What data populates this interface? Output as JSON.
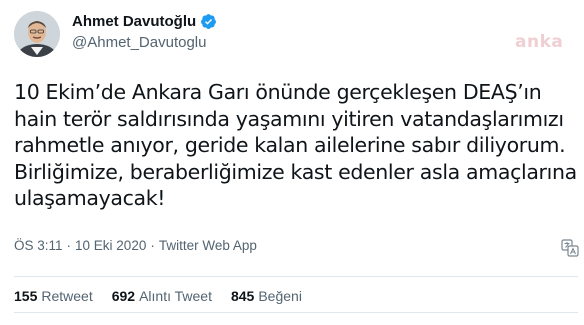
{
  "author": {
    "display_name": "Ahmet Davutoğlu",
    "handle": "@Ahmet_Davutoglu",
    "verified": true
  },
  "watermark": "anka",
  "tweet": {
    "lines": [
      "10 Ekim’de Ankara Garı önünde gerçekleşen DEAŞ’ın",
      "hain terör saldırısında yaşamını yitiren vatandaşlarımızı",
      "rahmetle anıyor, geride kalan ailelerine sabır diliyorum.",
      "Birliğimize, beraberliğimize kast edenler asla amaçlarına",
      "ulaşamayacak!"
    ]
  },
  "meta": {
    "time": "ÖS 3:11",
    "date": "10 Eki 2020",
    "source": "Twitter Web App",
    "separator": "·"
  },
  "stats": [
    {
      "count": "155",
      "label": "Retweet"
    },
    {
      "count": "692",
      "label": "Alıntı Tweet"
    },
    {
      "count": "845",
      "label": "Beğeni"
    }
  ],
  "colors": {
    "verified_badge": "#1d9bf0",
    "text_secondary": "#536471",
    "text_primary": "#0f1419",
    "divider": "#e1e8ed"
  },
  "icons": {
    "verified": "verified-badge-icon",
    "translate": "translate-icon"
  }
}
